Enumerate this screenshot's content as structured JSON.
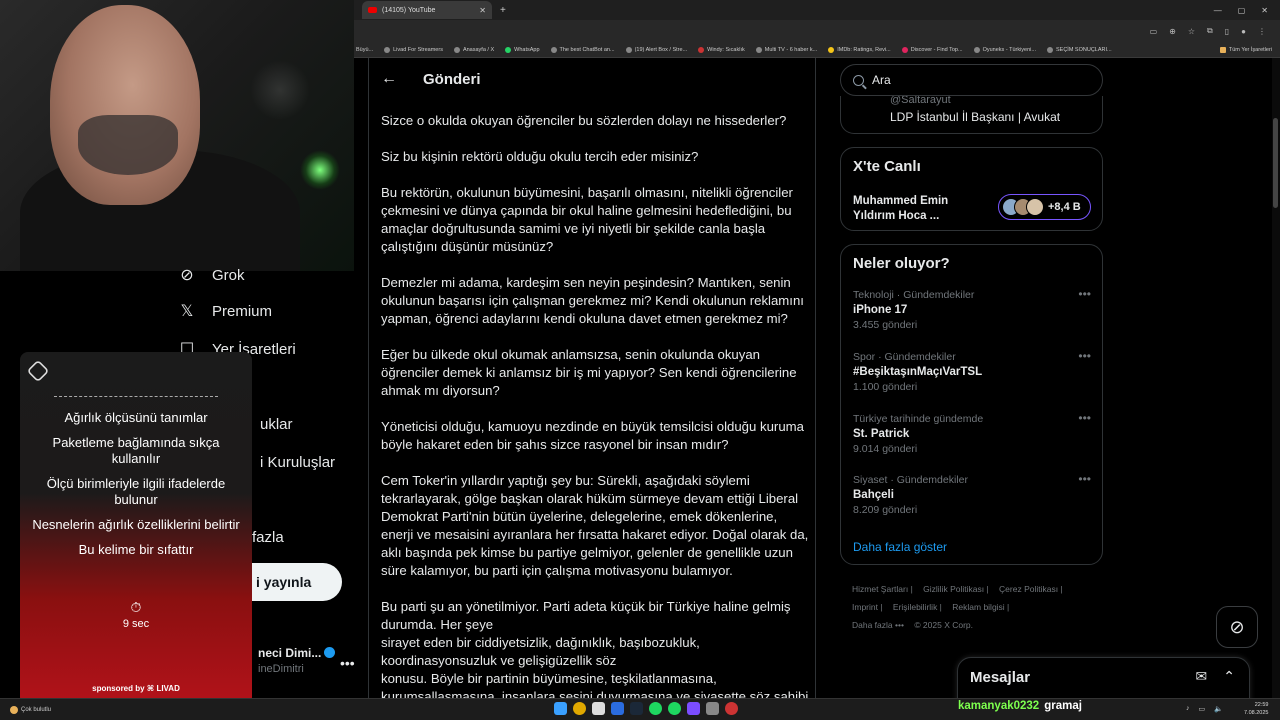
{
  "browser": {
    "tab_title": "(14105) YouTube",
    "new_tab": "+",
    "window_controls": [
      "—",
      "▢",
      "✕"
    ],
    "bookmarks": [
      "Büyü...",
      "Livad For Streamers",
      "Anasayfa / X",
      "WhatsApp",
      "The best ChatBot an...",
      "(19) Alert Box / Stre...",
      "Windy: Sıcaklık",
      "Multi TV - 6 haber k...",
      "IMDb: Ratings, Revi...",
      "Discover - Find Top...",
      "Oyuneks - Türkiyeni...",
      "SEÇİM SONUÇLARI..."
    ],
    "bookmarks_all": "Tüm Yer İşaretleri"
  },
  "leftnav": {
    "items": [
      {
        "label": "Grok",
        "icon": "grok-icon"
      },
      {
        "label": "Premium",
        "icon": "x-logo-icon"
      },
      {
        "label": "Yer İşaretleri",
        "icon": "bookmark-icon"
      },
      {
        "label": "uklar",
        "icon": ""
      },
      {
        "label": "i Kuruluşlar",
        "icon": ""
      },
      {
        "label": "fazla",
        "icon": ""
      }
    ],
    "post_button": "i yayınla",
    "account_name": "neci Dimi...",
    "account_handle": "ineDimitri",
    "account_more": "•••"
  },
  "overlay": {
    "dashes": "----------------------------------------",
    "items": [
      "Ağırlık ölçüsünü tanımlar",
      "Paketleme bağlamında sıkça kullanılır",
      "Ölçü birimleriyle ilgili ifadelerde bulunur",
      "Nesnelerin ağırlık özelliklerini belirtir",
      "Bu kelime bir sıfattır"
    ],
    "timer_icon": "⏱",
    "timer": "9 sec",
    "sponsor": "sponsored by ⌘ LIVAD",
    "colors": {
      "top": "#1b1b1b",
      "bottom": "#b3121a"
    }
  },
  "main": {
    "back_icon": "←",
    "title": "Gönderi",
    "paragraphs": [
      "Sizce o okulda okuyan öğrenciler bu sözlerden dolayı ne hissederler?",
      "Siz bu kişinin rektörü olduğu okulu tercih eder misiniz?",
      "Bu rektörün, okulunun büyümesini, başarılı olmasını, nitelikli öğrenciler çekmesini ve dünya çapında bir okul haline gelmesini hedeflediğini, bu amaçlar doğrultusunda samimi ve iyi niyetli bir şekilde canla başla çalıştığını düşünür müsünüz?",
      "Demezler mi adama, kardeşim sen neyin peşindesin? Mantıken, senin okulunun başarısı için çalışman gerekmez mi? Kendi okulunun reklamını yapman, öğrenci adaylarını kendi okuluna davet etmen gerekmez mi?",
      "Eğer bu ülkede okul okumak anlamsızsa, senin okulunda okuyan öğrenciler demek ki anlamsız bir iş mi yapıyor? Sen kendi öğrencilerine ahmak mı diyorsun?",
      "Yöneticisi olduğu, kamuoyu nezdinde en büyük temsilcisi olduğu kuruma böyle hakaret eden bir şahıs sizce rasyonel bir insan mıdır?",
      "Cem Toker'in yıllardır yaptığı şey bu: Sürekli, aşağıdaki söylemi tekrarlayarak, gölge başkan olarak hüküm sürmeye devam ettiği Liberal Demokrat Parti'nin bütün üyelerine, delegelerine, emek dökenlerine, enerji ve mesaisini ayıranlara her fırsatta hakaret ediyor. Doğal olarak da, aklı başında pek kimse bu partiye gelmiyor, gelenler de genellikle uzun süre kalamıyor, bu parti için çalışma motivasyonu bulamıyor."
    ],
    "last_lines": [
      "Bu parti şu an yönetilmiyor. Parti adeta küçük bir Türkiye haline gelmiş durumda. Her şeye",
      "sirayet eden bir ciddiyetsizlik, dağınıklık, başıbozukluk, koordinasyonsuzluk ve gelişigüzellik söz",
      "konusu. Böyle bir partinin büyümesine, teşkilatlanmasına,",
      "kurumsallaşmasına, insanlara sesini duyurmasına ve siyasette söz sahibi"
    ]
  },
  "right": {
    "search_placeholder": "Ara",
    "profile_handle": "@Saltarayut",
    "profile_bio": "LDP İstanbul İl Başkanı | Avukat",
    "live": {
      "title": "X'te Canlı",
      "host": "Muhammed Emin Yıldırım Hoca ...",
      "count": "+8,4 B"
    },
    "trends_title": "Neler oluyor?",
    "trends": [
      {
        "category": "Teknoloji · Gündemdekiler",
        "name": "iPhone 17",
        "count": "3.455 gönderi"
      },
      {
        "category": "Spor · Gündemdekiler",
        "name": "#BeşiktaşınMaçıVarTSL",
        "count": "1.100 gönderi"
      },
      {
        "category": "Türkiye tarihinde gündemde",
        "name": "St. Patrick",
        "count": "9.014 gönderi"
      },
      {
        "category": "Siyaset · Gündemdekiler",
        "name": "Bahçeli",
        "count": "8.209 gönderi"
      }
    ],
    "trend_more": "•••",
    "show_more": "Daha fazla göster",
    "footer": [
      "Hizmet Şartları |",
      "Gizlilik Politikası |",
      "Çerez Politikası |",
      "Imprint |",
      "Erişilebilirlik |",
      "Reklam bilgisi |",
      "Daha fazla •••",
      "© 2025 X Corp."
    ]
  },
  "grok_button": "⊘",
  "messages": {
    "title": "Mesajlar",
    "compose_icon": "✉",
    "expand_icon": "⌃"
  },
  "taskbar": {
    "weather": "Çok bulutlu",
    "chat_user": "kamanyak0232",
    "chat_message": "gramaj",
    "time": "22:59",
    "date": "7.08.2025"
  }
}
